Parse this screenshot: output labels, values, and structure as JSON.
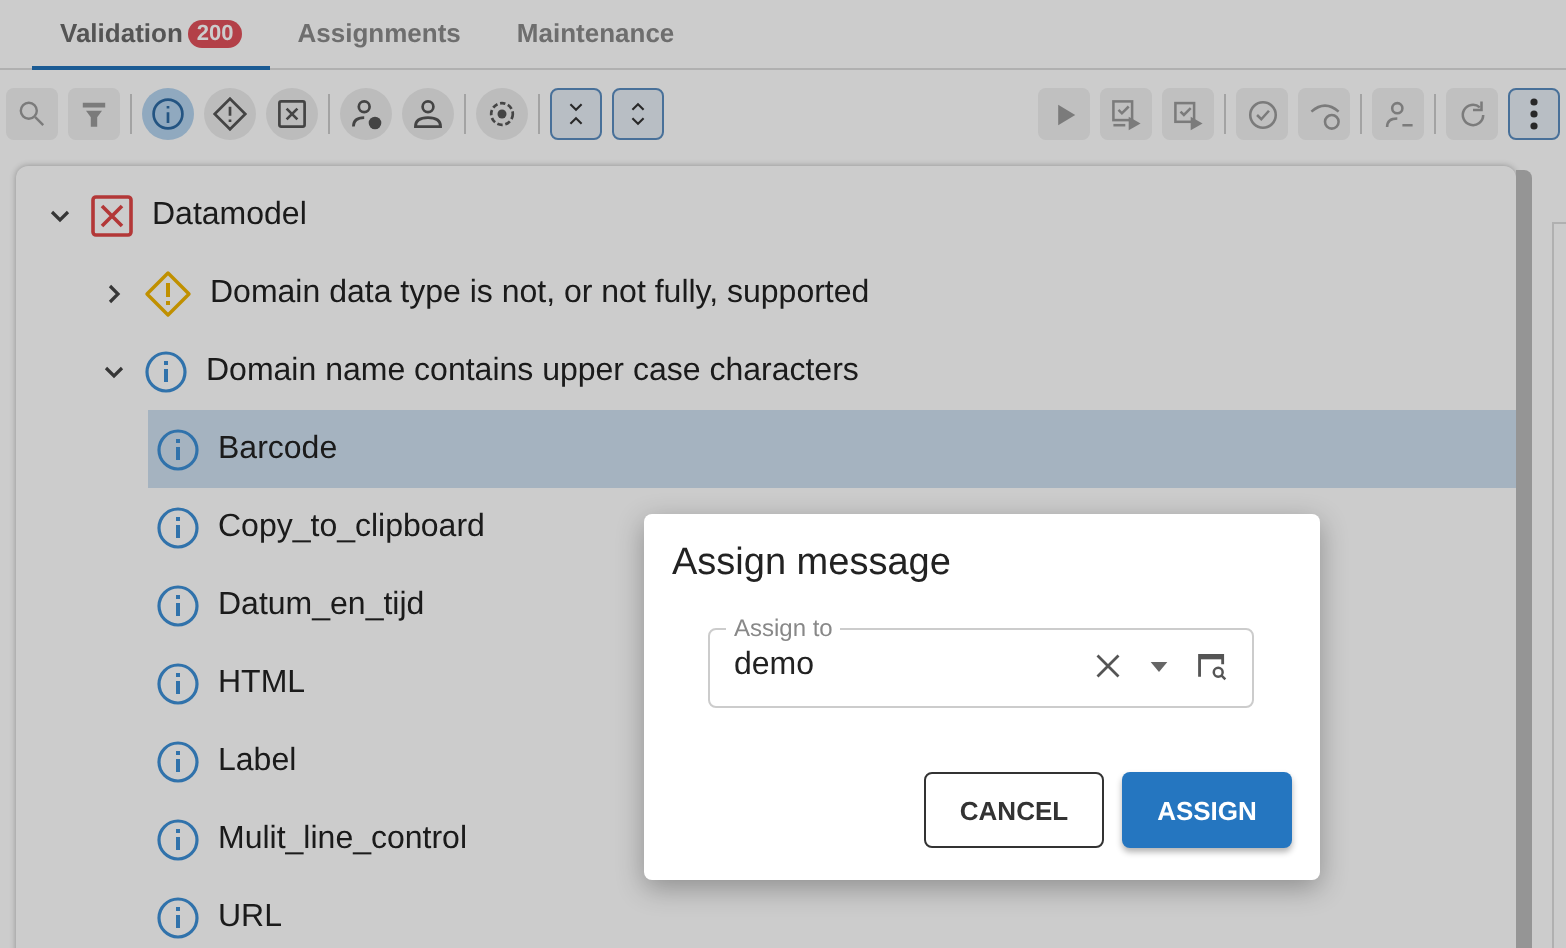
{
  "tabs": [
    {
      "label": "Validation",
      "badge": "200",
      "selected": true
    },
    {
      "label": "Assignments",
      "selected": false
    },
    {
      "label": "Maintenance",
      "selected": false
    }
  ],
  "toolbar": {
    "left": [
      {
        "disabled": true
      },
      {
        "disabled": true
      }
    ],
    "severity_filters": [
      {
        "kind": "info",
        "selected": true
      },
      {
        "kind": "warning",
        "selected": false
      },
      {
        "kind": "error",
        "selected": false
      }
    ],
    "right": [
      {
        "disabled": true
      },
      {
        "disabled": true
      },
      {
        "disabled": true
      },
      {
        "disabled": true
      },
      {
        "disabled": true
      },
      {
        "disabled": true
      },
      {
        "disabled": true
      },
      {
        "disabled": false
      }
    ]
  },
  "tree": [
    {
      "kind": "error",
      "label": "Datamodel",
      "expanded": true,
      "selected": false,
      "children": [
        {
          "kind": "warning",
          "label": "Domain data type is not, or not fully, supported",
          "expanded": false,
          "selected": false
        },
        {
          "kind": "info",
          "label": "Domain name contains upper case characters",
          "expanded": true,
          "selected": false,
          "children": [
            {
              "kind": "info",
              "label": "Barcode",
              "selected": true
            },
            {
              "kind": "info",
              "label": "Copy_to_clipboard",
              "selected": false
            },
            {
              "kind": "info",
              "label": "Datum_en_tijd",
              "selected": false
            },
            {
              "kind": "info",
              "label": "HTML",
              "selected": false
            },
            {
              "kind": "info",
              "label": "Label",
              "selected": false
            },
            {
              "kind": "info",
              "label": "Mulit_line_control",
              "selected": false
            },
            {
              "kind": "info",
              "label": "URL",
              "selected": false
            }
          ]
        }
      ]
    }
  ],
  "dialog": {
    "title": "Assign message",
    "field": {
      "label": "Assign to",
      "value": "demo"
    },
    "buttons": [
      {
        "label": "CANCEL",
        "kind": "outlined"
      },
      {
        "label": "ASSIGN",
        "kind": "primary"
      }
    ]
  }
}
